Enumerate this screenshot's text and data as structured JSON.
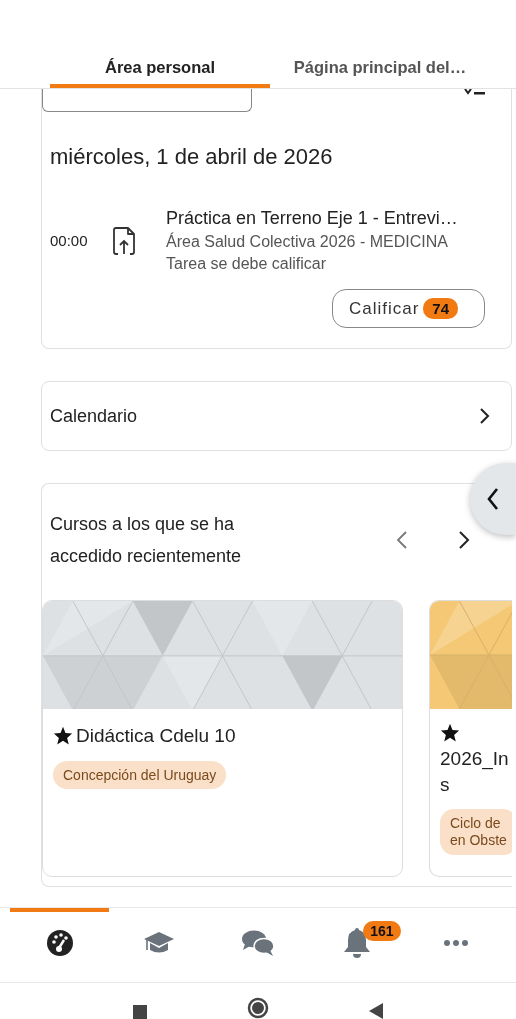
{
  "tabs": [
    {
      "label": "Área personal",
      "selected": true
    },
    {
      "label": "Página principal del…",
      "selected": false
    }
  ],
  "timeline": {
    "date": "miércoles, 1 de abril de 2026",
    "events": [
      {
        "time": "00:00",
        "title": "Práctica en Terreno Eje 1 - Entrevi…",
        "course": "Área Salud Colectiva 2026 - MEDICINA",
        "status": "Tarea se debe calificar",
        "action": "Calificar",
        "count": "74"
      }
    ]
  },
  "calendar": {
    "label": "Calendario"
  },
  "recent_courses": {
    "title": "Cursos a los que se ha accedido recientemente",
    "courses": [
      {
        "name": "Didáctica Cdelu 10",
        "starred": true,
        "category": "Concepción del Uruguay",
        "color": "#dde1e4"
      },
      {
        "name": "2026_In\ns",
        "starred": true,
        "category": "Ciclo de\nen Obste",
        "color": "#f4c874"
      }
    ]
  },
  "bottom_nav": [
    {
      "kind": "dashboard",
      "selected": true
    },
    {
      "kind": "courses",
      "selected": false
    },
    {
      "kind": "messages",
      "selected": false
    },
    {
      "kind": "notifications",
      "selected": false,
      "badge": "161"
    },
    {
      "kind": "more",
      "selected": false
    }
  ]
}
